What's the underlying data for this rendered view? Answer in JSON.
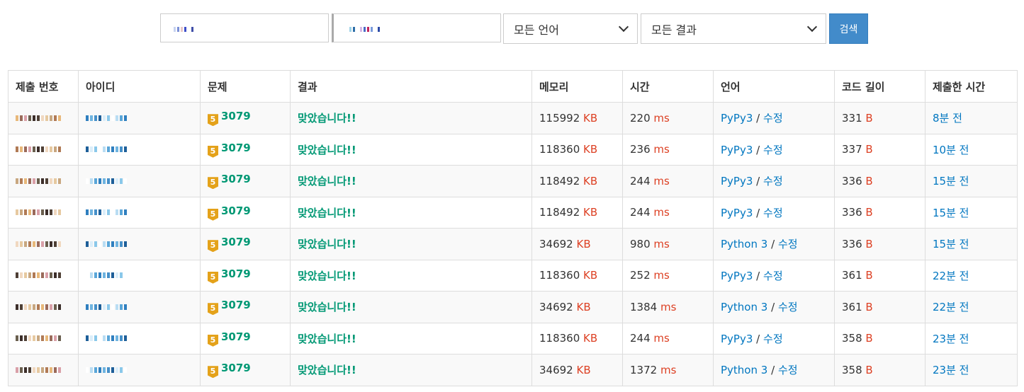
{
  "search": {
    "lang_select": "모든 언어",
    "result_select": "모든 결과",
    "button": "검색"
  },
  "table": {
    "headers": [
      "제출 번호",
      "아이디",
      "문제",
      "결과",
      "메모리",
      "시간",
      "언어",
      "코드 길이",
      "제출한 시간"
    ],
    "tier": "5",
    "edit": "수정",
    "separator": "/",
    "units": {
      "memory": "KB",
      "time": "ms",
      "length": "B"
    },
    "rows": [
      {
        "problem": "3079",
        "result": "맞았습니다!!",
        "memory": "115992",
        "time": "220",
        "lang": "PyPy3",
        "length": "331",
        "submitted": "8분 전"
      },
      {
        "problem": "3079",
        "result": "맞았습니다!!",
        "memory": "118360",
        "time": "236",
        "lang": "PyPy3",
        "length": "337",
        "submitted": "10분 전"
      },
      {
        "problem": "3079",
        "result": "맞았습니다!!",
        "memory": "118492",
        "time": "244",
        "lang": "PyPy3",
        "length": "336",
        "submitted": "15분 전"
      },
      {
        "problem": "3079",
        "result": "맞았습니다!!",
        "memory": "118492",
        "time": "244",
        "lang": "PyPy3",
        "length": "336",
        "submitted": "15분 전"
      },
      {
        "problem": "3079",
        "result": "맞았습니다!!",
        "memory": "34692",
        "time": "980",
        "lang": "Python 3",
        "length": "336",
        "submitted": "15분 전"
      },
      {
        "problem": "3079",
        "result": "맞았습니다!!",
        "memory": "118360",
        "time": "252",
        "lang": "PyPy3",
        "length": "361",
        "submitted": "22분 전"
      },
      {
        "problem": "3079",
        "result": "맞았습니다!!",
        "memory": "34692",
        "time": "1384",
        "lang": "Python 3",
        "length": "361",
        "submitted": "22분 전"
      },
      {
        "problem": "3079",
        "result": "맞았습니다!!",
        "memory": "118360",
        "time": "244",
        "lang": "PyPy3",
        "length": "358",
        "submitted": "23분 전"
      },
      {
        "problem": "3079",
        "result": "맞았습니다!!",
        "memory": "34692",
        "time": "1372",
        "lang": "Python 3",
        "length": "358",
        "submitted": "23분 전"
      }
    ]
  }
}
